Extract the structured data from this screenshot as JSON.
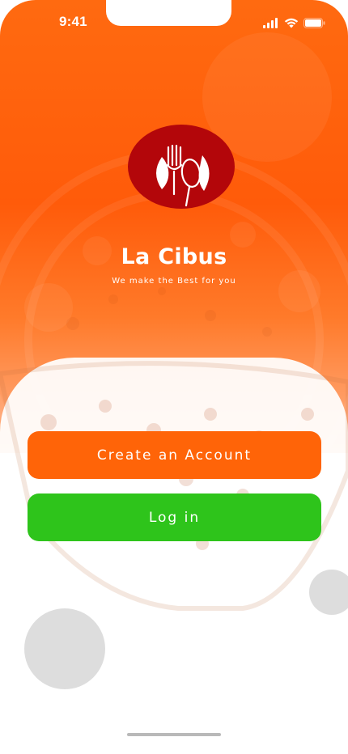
{
  "status_bar": {
    "time": "9:41",
    "icons": [
      "signal-icon",
      "wifi-icon",
      "battery-icon"
    ]
  },
  "brand": {
    "logo_icon": "fork-spoon-icon",
    "title": "La Cibus",
    "tagline": "We make the Best for you"
  },
  "actions": {
    "create_account_label": "Create an Account",
    "login_label": "Log in"
  },
  "colors": {
    "primary_orange": "#ff6408",
    "logo_red": "#b3060a",
    "login_green": "#2ec41b",
    "sheet_white": "#ffffff"
  }
}
